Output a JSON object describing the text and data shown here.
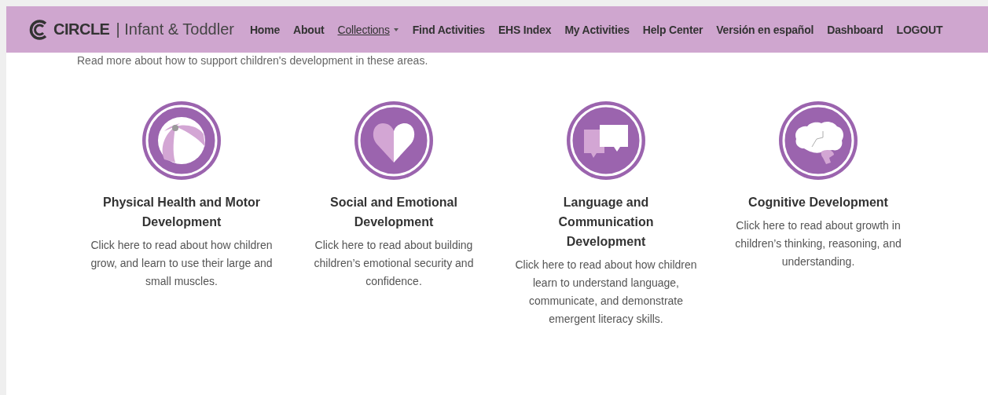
{
  "header": {
    "logo": "CIRCLE",
    "subtitle": "| Infant & Toddler",
    "nav": [
      {
        "label": "Home",
        "selected": false,
        "dropdown": false
      },
      {
        "label": "About",
        "selected": false,
        "dropdown": false
      },
      {
        "label": "Collections",
        "selected": true,
        "dropdown": true
      },
      {
        "label": "Find Activities",
        "selected": false,
        "dropdown": false
      },
      {
        "label": "EHS Index",
        "selected": false,
        "dropdown": false
      },
      {
        "label": "My Activities",
        "selected": false,
        "dropdown": false
      },
      {
        "label": "Help Center",
        "selected": false,
        "dropdown": false
      },
      {
        "label": "Versión en español",
        "selected": false,
        "dropdown": false
      },
      {
        "label": "Dashboard",
        "selected": false,
        "dropdown": false
      },
      {
        "label": "LOGOUT",
        "selected": false,
        "dropdown": false
      }
    ]
  },
  "intro": "Read more about how to support children's development in these areas.",
  "areas": [
    {
      "title": "Physical Health and Motor Development",
      "description": "Click here to read about how children grow, and learn to use their large and small muscles."
    },
    {
      "title": "Social and Emotional Development",
      "description": "Click here to read about building children’s emotional security and confidence."
    },
    {
      "title": "Language and Communication Development",
      "description": "Click here to read about how children learn to understand language, communicate, and demonstrate emergent literacy skills."
    },
    {
      "title": "Cognitive Development",
      "description": "Click here to read about growth in children’s thinking, reasoning, and understanding."
    }
  ]
}
